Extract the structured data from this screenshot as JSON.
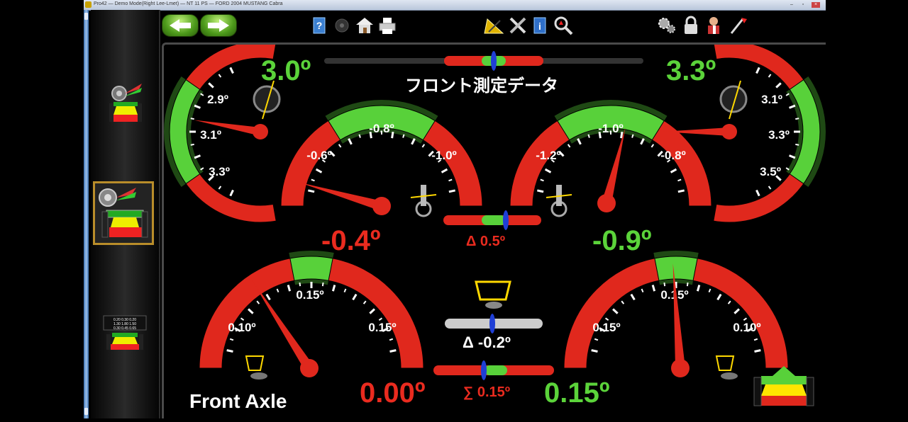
{
  "window": {
    "title": "Pro42 — Demo Mode(Right Lee-Lmet) — NT 11 PS — FORD 2004 MUSTANG Cabra"
  },
  "toolbar": {
    "back_icon": "back-arrow-icon",
    "forward_icon": "forward-arrow-icon",
    "help_icon": "help-book-icon",
    "home_icon": "home-icon",
    "print_icon": "printer-icon",
    "adjust_icon": "wrench-screwdriver-icon",
    "info_icon": "info-book-icon",
    "zoom_icon": "magnifier-icon",
    "settings_icon": "gears-icon",
    "lock_icon": "padlock-icon",
    "user_icon": "technician-icon",
    "exit_icon": "exit-icon"
  },
  "screen": {
    "title": "フロント測定データ",
    "section": "Front Axle"
  },
  "caster": {
    "left": {
      "value": "3.0º",
      "ticks": [
        "2.9º",
        "3.1º",
        "3.3º"
      ]
    },
    "right": {
      "value": "3.3º",
      "ticks": [
        "3.1º",
        "3.3º",
        "3.5º"
      ]
    }
  },
  "camber": {
    "left": {
      "value": "-0.4º",
      "ticks": [
        "-0.6º",
        "-0.8º",
        "-1.0º"
      ]
    },
    "right": {
      "value": "-0.9º",
      "ticks": [
        "-1.2º",
        "-1.0º",
        "-0.8º"
      ]
    },
    "cross": "Δ 0.5º"
  },
  "toe": {
    "left": {
      "value": "0.00º",
      "ticks": [
        "0.10º",
        "0.15º",
        "0.15º"
      ]
    },
    "right": {
      "value": "0.15º",
      "ticks": [
        "0.15º",
        "0.15º",
        "0.10º"
      ]
    },
    "setback": "Δ -0.2º",
    "total": "∑ 0.15º"
  },
  "sidebar": {
    "items": [
      {
        "name": "caster-camber-view"
      },
      {
        "name": "front-axle-view"
      },
      {
        "name": "summary-table-view",
        "table": "0.20 0.30 0.20 / 1.30 1.80 1.50 / 0.30 0.45 0.65"
      }
    ]
  },
  "colors": {
    "green": "#58d13a",
    "red": "#e0281d",
    "text_green": "#5bd33a",
    "text_red": "#ea2b1f"
  }
}
